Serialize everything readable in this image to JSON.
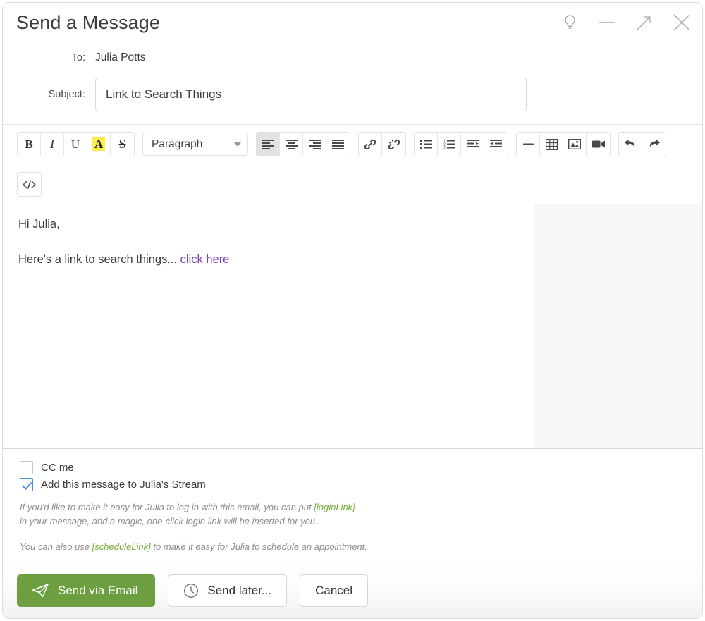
{
  "window": {
    "title": "Send a Message",
    "controls": [
      {
        "name": "lightbulb-icon",
        "label": "Tips"
      },
      {
        "name": "minimize-icon",
        "label": "Minimize"
      },
      {
        "name": "collapse-icon",
        "label": "Restore"
      },
      {
        "name": "close-icon",
        "label": "Close"
      }
    ]
  },
  "fields": {
    "to_label": "To:",
    "to_value": "Julia Potts",
    "subject_label": "Subject:",
    "subject_value": "Link to Search Things",
    "subject_placeholder": "Subject"
  },
  "toolbar": {
    "bold": "B",
    "italic": "I",
    "underline": "U",
    "highlight": "A",
    "strikethrough": "S",
    "paragraph_style": "Paragraph",
    "code_view": "</>"
  },
  "editor": {
    "greeting": "Hi Julia,",
    "body_text": "Here's a link to search things... ",
    "link_text": "click here",
    "link_color": "#7a3fb5"
  },
  "options": {
    "cc_me_label": "CC me",
    "cc_me_checked": false,
    "stream_label": "Add this message to Julia's Stream",
    "stream_checked": true,
    "hint_line1_a": "If you'd like to make it easy for Julia to log in with this email, you can put ",
    "hint_token1": "[loginLink]",
    "hint_line1_b": "",
    "hint_line2": "in your message, and a magic, one-click login link will be inserted for you.",
    "hint_line3_a": "You can also use ",
    "hint_token2": "[scheduleLink]",
    "hint_line3_b": " to make it easy for Julia to schedule an appointment.",
    "token_color": "#7aa93c"
  },
  "footer": {
    "send_label": "Send via Email",
    "send_later_label": "Send later...",
    "cancel_label": "Cancel",
    "primary_color": "#6d9e3f"
  }
}
